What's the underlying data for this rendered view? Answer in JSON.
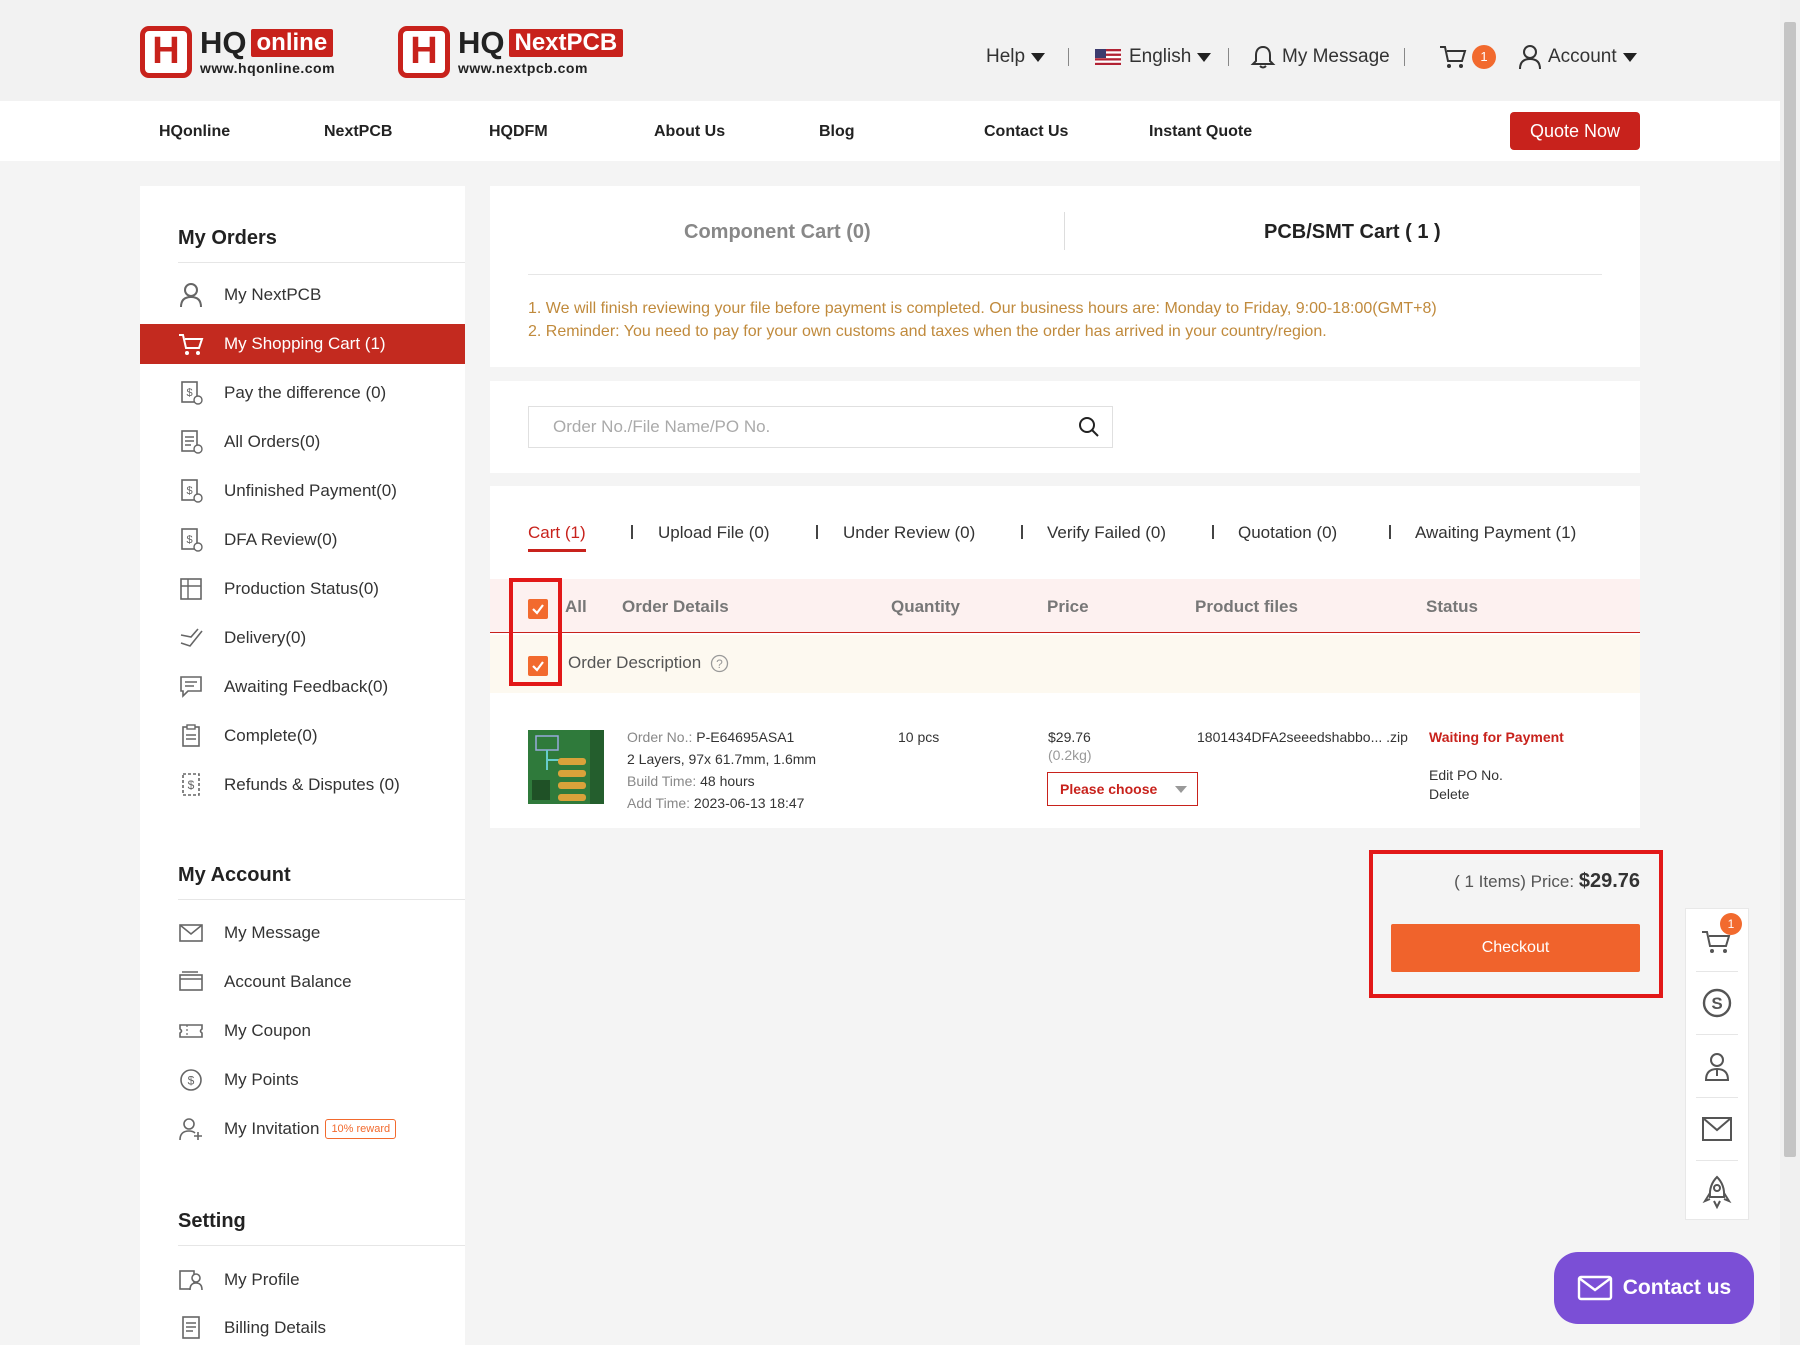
{
  "header": {
    "logo1": {
      "name": "HQ",
      "badge": "online",
      "url": "www.hqonline.com"
    },
    "logo2": {
      "name": "HQ",
      "badge": "NextPCB",
      "url": "www.nextpcb.com"
    },
    "help": "Help",
    "language": "English",
    "message": "My Message",
    "cart_count": "1",
    "account": "Account"
  },
  "mainnav": {
    "items": [
      "HQonline",
      "NextPCB",
      "HQDFM",
      "About Us",
      "Blog",
      "Contact Us",
      "Instant Quote"
    ],
    "quote_button": "Quote Now"
  },
  "sidebar": {
    "orders_title": "My Orders",
    "orders": [
      {
        "label": "My NextPCB",
        "icon": "user-icon"
      },
      {
        "label": "My Shopping Cart (1)",
        "icon": "cart-icon"
      },
      {
        "label": "Pay the difference (0)",
        "icon": "dollar-doc-icon"
      },
      {
        "label": "All Orders(0)",
        "icon": "orders-icon"
      },
      {
        "label": "Unfinished Payment(0)",
        "icon": "dollar-doc-icon"
      },
      {
        "label": "DFA Review(0)",
        "icon": "dollar-doc-icon"
      },
      {
        "label": "Production Status(0)",
        "icon": "production-icon"
      },
      {
        "label": "Delivery(0)",
        "icon": "delivery-icon"
      },
      {
        "label": "Awaiting Feedback(0)",
        "icon": "feedback-icon"
      },
      {
        "label": "Complete(0)",
        "icon": "clipboard-icon"
      },
      {
        "label": "Refunds & Disputes (0)",
        "icon": "refund-icon"
      }
    ],
    "account_title": "My Account",
    "account": [
      {
        "label": "My Message",
        "icon": "mail-icon"
      },
      {
        "label": "Account Balance",
        "icon": "wallet-icon"
      },
      {
        "label": "My Coupon",
        "icon": "coupon-icon"
      },
      {
        "label": "My Points",
        "icon": "points-icon"
      },
      {
        "label": "My Invitation",
        "icon": "invite-icon"
      }
    ],
    "reward_badge": "10% reward",
    "setting_title": "Setting",
    "setting": [
      {
        "label": "My Profile",
        "icon": "profile-icon"
      },
      {
        "label": "Billing Details",
        "icon": "billing-icon"
      }
    ]
  },
  "cart_tabs": {
    "component": "Component Cart (0)",
    "pcb": "PCB/SMT Cart ( 1 )"
  },
  "notices": [
    "1. We will finish reviewing your file before payment is completed. Our business hours are: Monday to Friday, 9:00-18:00(GMT+8)",
    "2. Reminder: You need to pay for your own customs and taxes when the order has arrived in your country/region."
  ],
  "search": {
    "placeholder": "Order No./File Name/PO No."
  },
  "status_tabs": [
    "Cart (1)",
    "Upload File (0)",
    "Under Review (0)",
    "Verify Failed (0)",
    "Quotation (0)",
    "Awaiting Payment (1)"
  ],
  "table": {
    "all": "All",
    "headers": [
      "Order Details",
      "Quantity",
      "Price",
      "Product files",
      "Status"
    ],
    "order_description": "Order Description"
  },
  "order": {
    "order_no_label": "Order No.:",
    "order_no": "P-E64695ASA1",
    "spec": "2 Layers, 97x 61.7mm, 1.6mm",
    "build_label": "Build Time:",
    "build_time": "48 hours",
    "add_label": "Add Time:",
    "add_time": "2023-06-13 18:47",
    "quantity": "10 pcs",
    "price": "$29.76",
    "weight": "(0.2kg)",
    "shipping_select": "Please choose",
    "file": "1801434DFA2seeedshabbo... .zip",
    "status": "Waiting for Payment",
    "edit_po": "Edit PO No.",
    "delete": "Delete"
  },
  "summary": {
    "items_text": "( 1 Items) Price:",
    "total": "$29.76",
    "checkout": "Checkout"
  },
  "floatbar": {
    "cart_count": "1"
  },
  "contact": "Contact us",
  "colors": {
    "brand_red": "#c8221c",
    "orange": "#f0632c",
    "notice": "#c08a3c",
    "contact_purple": "#7b4fd6"
  }
}
